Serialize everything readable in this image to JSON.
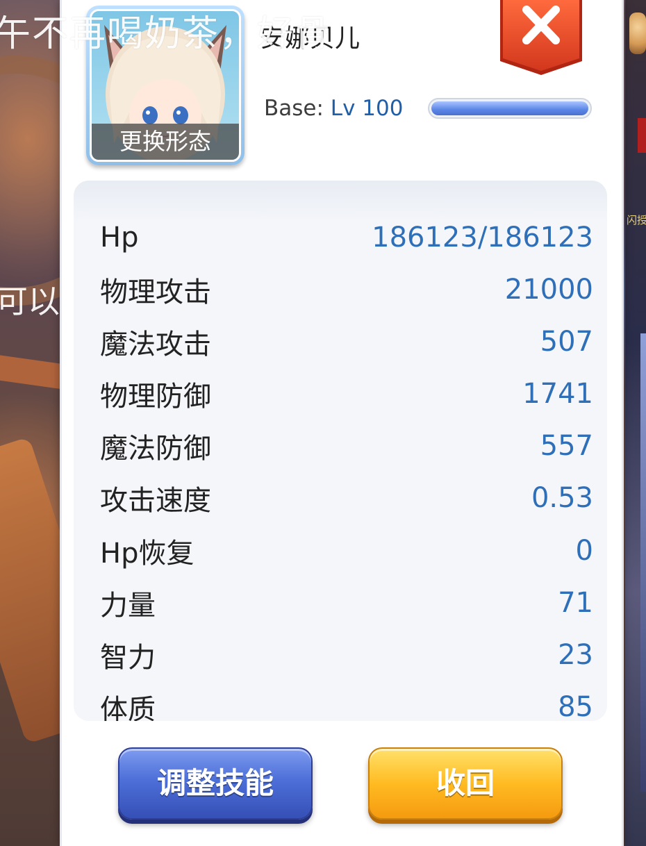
{
  "overlay": {
    "danmaku_top": "午不再喝奶茶，好骨",
    "danmaku_mid": "可以"
  },
  "background": {
    "side_hint": "闪授"
  },
  "character": {
    "name": "安娜贝儿",
    "change_form_label": "更换形态",
    "level_prefix": "Base:",
    "level_value": "Lv 100",
    "exp_progress": 1.0
  },
  "stats": {
    "rows": [
      {
        "label": "Hp",
        "value": "186123/186123"
      },
      {
        "label": "物理攻击",
        "value": "21000"
      },
      {
        "label": "魔法攻击",
        "value": "507"
      },
      {
        "label": "物理防御",
        "value": "1741"
      },
      {
        "label": "魔法防御",
        "value": "557"
      },
      {
        "label": "攻击速度",
        "value": "0.53"
      },
      {
        "label": "Hp恢复",
        "value": "0"
      },
      {
        "label": "力量",
        "value": "71"
      },
      {
        "label": "智力",
        "value": "23"
      },
      {
        "label": "体质",
        "value": "85"
      }
    ]
  },
  "buttons": {
    "adjust_skills": "调整技能",
    "recall": "收回"
  },
  "colors": {
    "value_blue": "#2f6fb8",
    "close_red": "#e24a2a",
    "skill_button_blue": "#4d6fd8",
    "recall_button_orange": "#ffbb22"
  },
  "icons": {
    "close": "close-x-icon"
  }
}
